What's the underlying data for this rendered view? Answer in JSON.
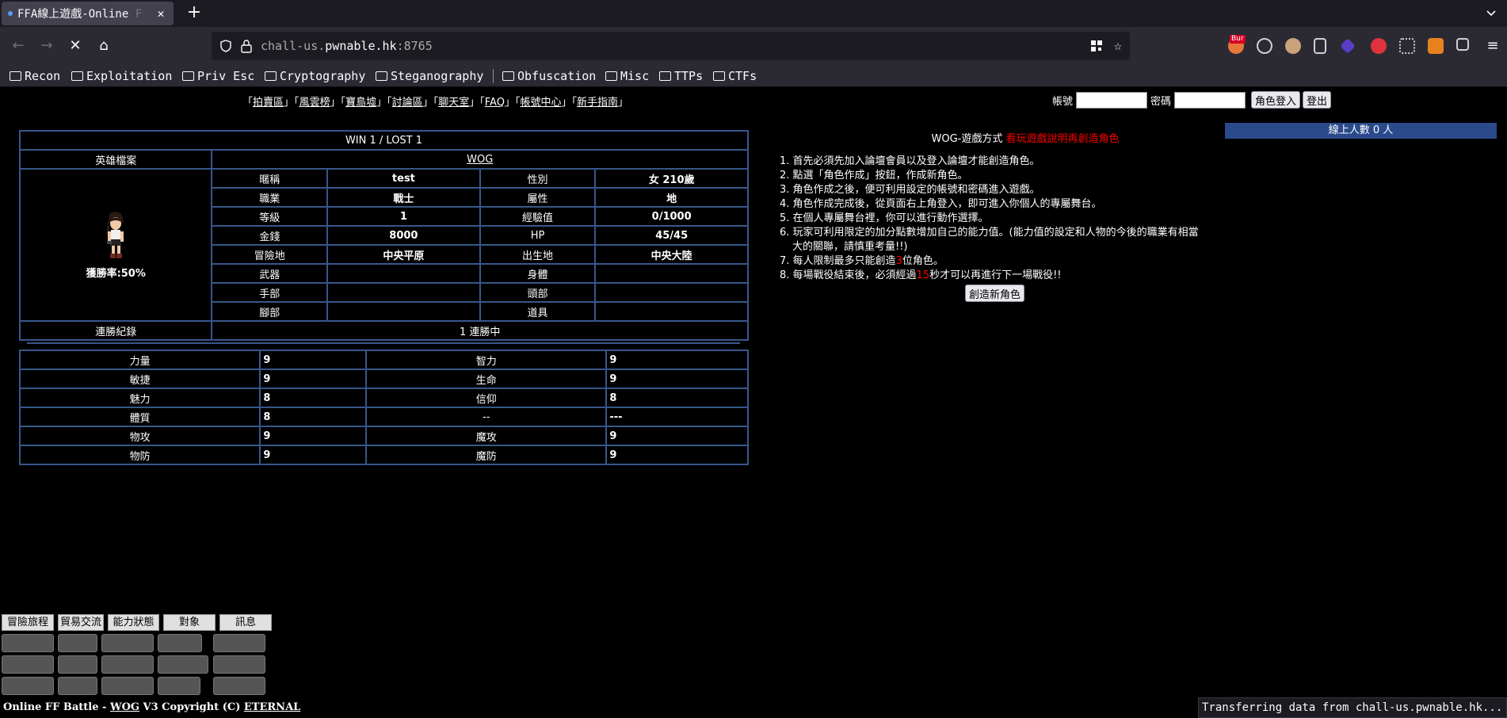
{
  "browser": {
    "tab_title": "FFA線上遊戲-Online",
    "tab_title_fade": "F",
    "url_prefix": "chall-us.",
    "url_domain": "pwnable.hk",
    "url_port": ":8765",
    "extension_badge": "Bur",
    "bookmarks": [
      "Recon",
      "Exploitation",
      "Priv Esc",
      "Cryptography",
      "Steganography",
      "Obfuscation",
      "Misc",
      "TTPs",
      "CTFs"
    ],
    "status_text": "Transferring data from chall-us.pwnable.hk..."
  },
  "nav": {
    "open": "「",
    "close": "」",
    "links": [
      "拍賣區",
      "風雲榜",
      "寶島墟",
      "討論區",
      "聊天室",
      "FAQ",
      "帳號中心",
      "新手指南"
    ]
  },
  "login": {
    "account_label": "帳號",
    "password_label": "密碼",
    "login_button": "角色登入",
    "logout_button": "登出"
  },
  "hero": {
    "record": "WIN 1 / LOST 1",
    "profile_label": "英雄檔案",
    "profile_name": "WOG",
    "win_rate_label": "獲勝率:",
    "win_rate": "50%",
    "fields": [
      {
        "l1": "暱稱",
        "v1": "test",
        "l2": "性別",
        "v2": "女 210歲"
      },
      {
        "l1": "職業",
        "v1": "戰士",
        "l2": "屬性",
        "v2": "地"
      },
      {
        "l1": "等級",
        "v1": "1",
        "l2": "經驗值",
        "v2": "0/1000"
      },
      {
        "l1": "金錢",
        "v1": "8000",
        "l2": "HP",
        "v2": "45/45"
      },
      {
        "l1": "冒險地",
        "v1": "中央平原",
        "l2": "出生地",
        "v2": "中央大陸"
      },
      {
        "l1": "武器",
        "v1": "",
        "l2": "身體",
        "v2": ""
      },
      {
        "l1": "手部",
        "v1": "",
        "l2": "頭部",
        "v2": ""
      },
      {
        "l1": "腳部",
        "v1": "",
        "l2": "道具",
        "v2": ""
      }
    ],
    "streak_label": "連勝紀錄",
    "streak_value": "1 連勝中"
  },
  "stats": [
    {
      "l1": "力量",
      "v1": "9",
      "l2": "智力",
      "v2": "9"
    },
    {
      "l1": "敏捷",
      "v1": "9",
      "l2": "生命",
      "v2": "9"
    },
    {
      "l1": "魅力",
      "v1": "8",
      "l2": "信仰",
      "v2": "8"
    },
    {
      "l1": "體質",
      "v1": "8",
      "l2": "--",
      "v2": "---"
    },
    {
      "l1": "物攻",
      "v1": "9",
      "l2": "魔攻",
      "v2": "9"
    },
    {
      "l1": "物防",
      "v1": "9",
      "l2": "魔防",
      "v2": "9"
    }
  ],
  "guide": {
    "title": "WOG-遊戲方式",
    "title_red": "看玩遊戲說明再創造角色",
    "items": [
      "1. 首先必須先加入論壇會員以及登入論壇才能創造角色。",
      "2. 點選「角色作成」按鈕，作成新角色。",
      "3. 角色作成之後，便可利用設定的帳號和密碼進入遊戲。",
      "4. 角色作成完成後，從頁面右上角登入，即可進入你個人的專屬舞台。",
      "5. 在個人專屬舞台裡，你可以進行動作選擇。",
      "6. 玩家可利用限定的加分點數增加自己的能力值。(能力值的設定和人物的今後的職業有相當大的關聯，請慎重考量!!)"
    ],
    "item7_before": "7. 每人限制最多只能創造",
    "item7_num": "3",
    "item7_after": "位角色。",
    "item8_before": "8. 每場戰役結束後，必須經過",
    "item8_num": "15",
    "item8_after": "秒才可以再進行下一場戰役!!",
    "create_button": "創造新角色"
  },
  "online": "線上人數 0 人",
  "menu": {
    "tabs": [
      "冒險旅程",
      "貿易交流",
      "能力狀態",
      "對象",
      "訊息"
    ]
  },
  "footer": {
    "prefix": "Online FF Battle - ",
    "wog": "WOG",
    "middle": " V3 Copyright (C) ",
    "eternal": "ETERNAL"
  },
  "colors": {
    "table_border": "#37578b",
    "online_bar": "#2b4a8c",
    "highlight_red": "#ff0000"
  }
}
